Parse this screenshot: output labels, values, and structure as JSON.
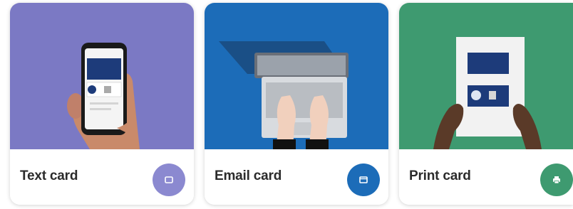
{
  "cards": [
    {
      "label": "Text card",
      "media_bg": "#7b79c4",
      "action_color": "#8b89d0",
      "action_icon": "message-icon"
    },
    {
      "label": "Email card",
      "media_bg": "#1c6cb8",
      "action_color": "#1c6cb8",
      "action_icon": "envelope-icon"
    },
    {
      "label": "Print card",
      "media_bg": "#3e9a70",
      "action_color": "#3e9a70",
      "action_icon": "printer-icon"
    }
  ]
}
